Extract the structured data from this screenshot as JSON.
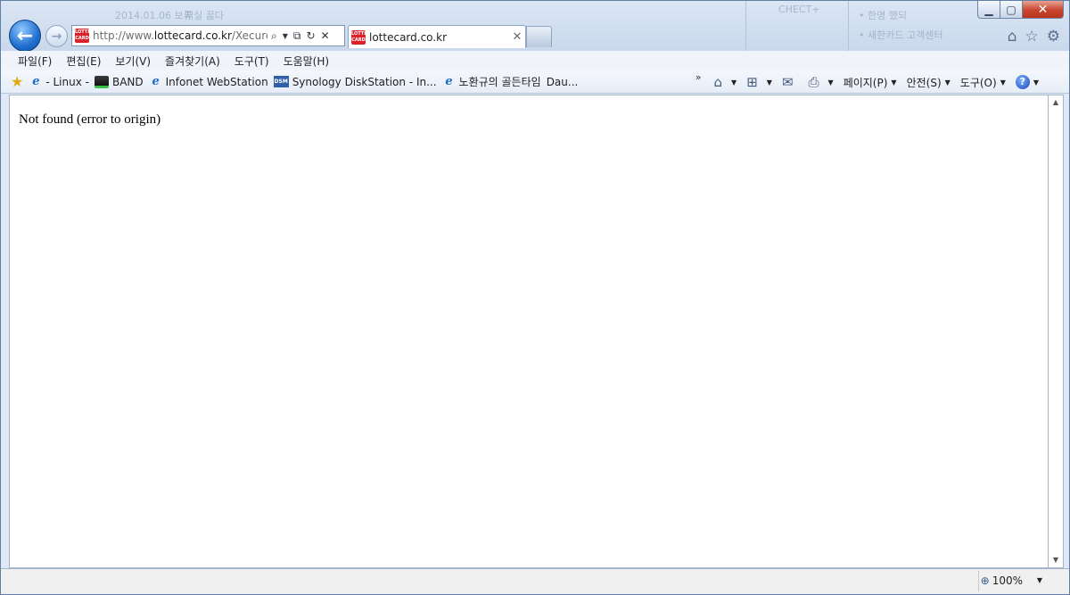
{
  "browser": {
    "address": {
      "prefix": "http://www.",
      "domain": "lottecard.co.kr",
      "path": "/XecureOb"
    },
    "site_icon_text": [
      "LOTTE",
      "CARD"
    ],
    "tab": {
      "title": "lottecard.co.kr"
    }
  },
  "background_ghost": {
    "left_a": "2014.01.06 보류",
    "left_b": "저실 꿇다",
    "mid": "CHECT+",
    "right_a": "• 한명 했되",
    "right_b": "• 새한카드 고객센터"
  },
  "menu": {
    "items": [
      "파일(F)",
      "편집(E)",
      "보기(V)",
      "즐겨찾기(A)",
      "도구(T)",
      "도움말(H)"
    ]
  },
  "favorites": {
    "items": [
      {
        "label": "- Linux -",
        "icon": "ie-page-icon"
      },
      {
        "label": "BAND",
        "icon": "band-icon"
      },
      {
        "label": "Infonet WebStation",
        "icon": "ie-page-icon"
      },
      {
        "label": "Synology DiskStation - In...",
        "icon": "dsm-icon"
      },
      {
        "label": "노환규의 골든타임",
        "icon": "ie-page-icon"
      },
      {
        "label": "Dau...",
        "icon": "none"
      }
    ],
    "overflow": "»"
  },
  "command_bar": {
    "page": "페이지(P)",
    "safety": "안전(S)",
    "tools": "도구(O)"
  },
  "page": {
    "message": "Not found (error to origin)"
  },
  "status": {
    "zoom": "100%"
  },
  "colors": {
    "frame": "#c9d8ec",
    "accent": "#1f6fd0",
    "close": "#c7452e",
    "brand": "#d8232a"
  }
}
